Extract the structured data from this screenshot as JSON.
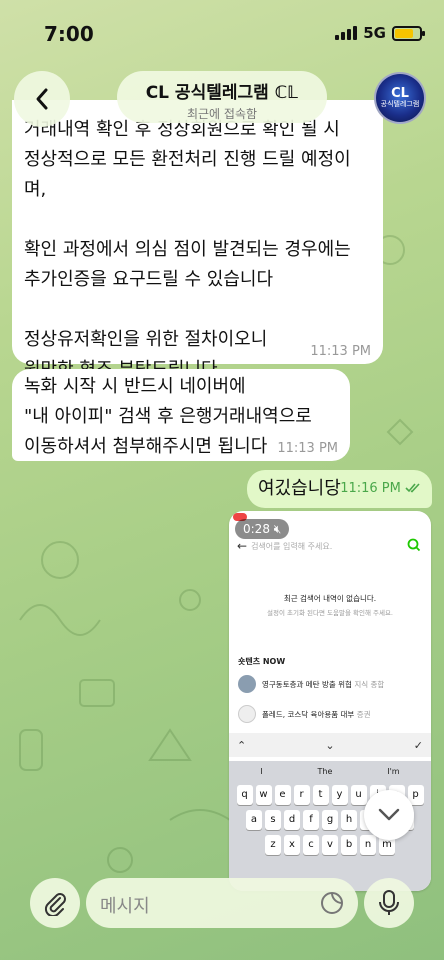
{
  "status_bar": {
    "time": "7:00",
    "network": "5G",
    "battery_level": 0.75
  },
  "header": {
    "title": "CL 공식텔레그램 ℂ𝕃",
    "subtitle": "최근에 접속함",
    "avatar": {
      "logo": "CL",
      "caption": "공식텔레그램"
    }
  },
  "messages": [
    {
      "direction": "in",
      "lines": [
        "거래내역 확인 후 정상회원으로 확인 될 시",
        "정상적으로 모든 환전처리 진행 드릴 예정이",
        "며,",
        "",
        "확인 과정에서 의심 점이 발견되는 경우에는",
        "추가인증을 요구드릴 수 있습니다",
        "",
        "정상유저확인을 위한 절차이오니",
        "원만한 협조 부탁드립니다."
      ],
      "time": "11:13 PM"
    },
    {
      "direction": "in",
      "lines": [
        "녹화 시작 시 반드시 네이버에",
        "\"내 아이피\" 검색 후 은행거래내역으로",
        "이동하셔서 첨부해주시면 됩니다"
      ],
      "time": "11:13 PM"
    },
    {
      "direction": "out",
      "text": "여깄습니당",
      "time": "11:16 PM",
      "status_icon": "double-check-icon"
    }
  ],
  "media": {
    "video_duration": "0:28",
    "muted_icon": "speaker-muted-icon",
    "screen": {
      "search_placeholder": "검색어를 입력해 주세요.",
      "empty_title": "최근 검색어 내역이 없습니다.",
      "empty_sub": "설정이 초기화 된다면 도움말을 확인해 주세요.",
      "section_title": "숏텐츠 NOW",
      "items": [
        {
          "text": "영구동토층과 메탄 방출 위협",
          "tag": "지식 종합"
        },
        {
          "text": "폴레드, 코스닥 육아용품 대부",
          "tag": "증권"
        }
      ],
      "keyboard_suggestions": [
        "I",
        "The",
        "I'm"
      ],
      "keyboard_rows": [
        [
          "q",
          "w",
          "e",
          "r",
          "t",
          "y",
          "u",
          "i",
          "o",
          "p"
        ],
        [
          "a",
          "s",
          "d",
          "f",
          "g",
          "h",
          "j",
          "k",
          "l"
        ],
        [
          "z",
          "x",
          "c",
          "v",
          "b",
          "n",
          "m"
        ]
      ]
    }
  },
  "input": {
    "placeholder": "메시지"
  },
  "colors": {
    "incoming_bubble": "#ffffff",
    "outgoing_bubble": "#e2f8c8",
    "outgoing_time": "#4aa74a"
  }
}
